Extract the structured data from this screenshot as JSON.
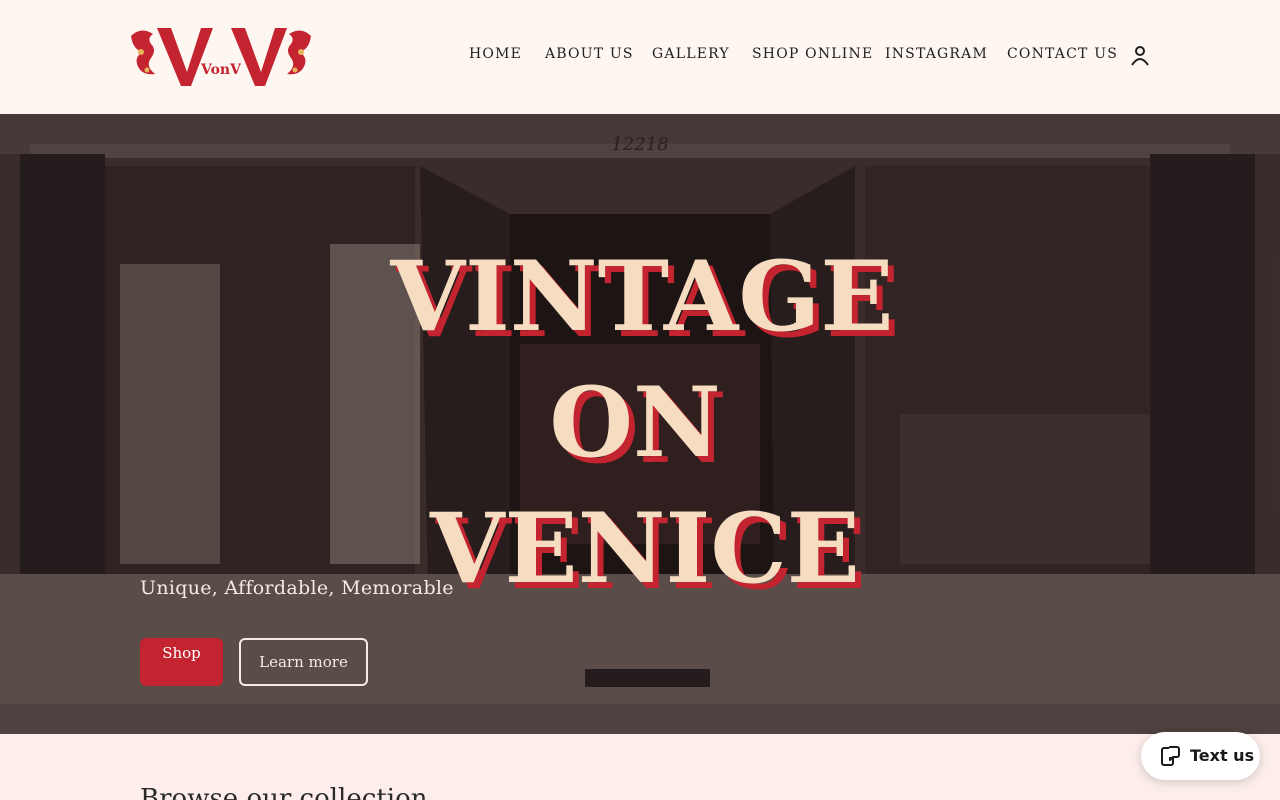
{
  "header": {
    "logo_text": "VonV",
    "nav": [
      {
        "label": "HOME"
      },
      {
        "label": "ABOUT US"
      },
      {
        "label": "GALLERY"
      },
      {
        "label": "SHOP ONLINE"
      },
      {
        "label": "INSTAGRAM"
      },
      {
        "label": "CONTACT US"
      }
    ],
    "account_icon": "user-icon"
  },
  "hero": {
    "title_lines": [
      "VINTAGE",
      "ON",
      "VENICE"
    ],
    "storefront_number": "12218",
    "tagline": "Unique, Affordable, Memorable",
    "shop_label": "Shop",
    "learn_label": "Learn more"
  },
  "section": {
    "title": "Browse our collection"
  },
  "chat": {
    "label": "Text us",
    "icon": "chat-phone-icon"
  },
  "colors": {
    "brand_red": "#c3242f",
    "header_bg": "#fef6f1",
    "page_bg": "#fdeeeb",
    "title_cream": "#f6dcc0"
  }
}
